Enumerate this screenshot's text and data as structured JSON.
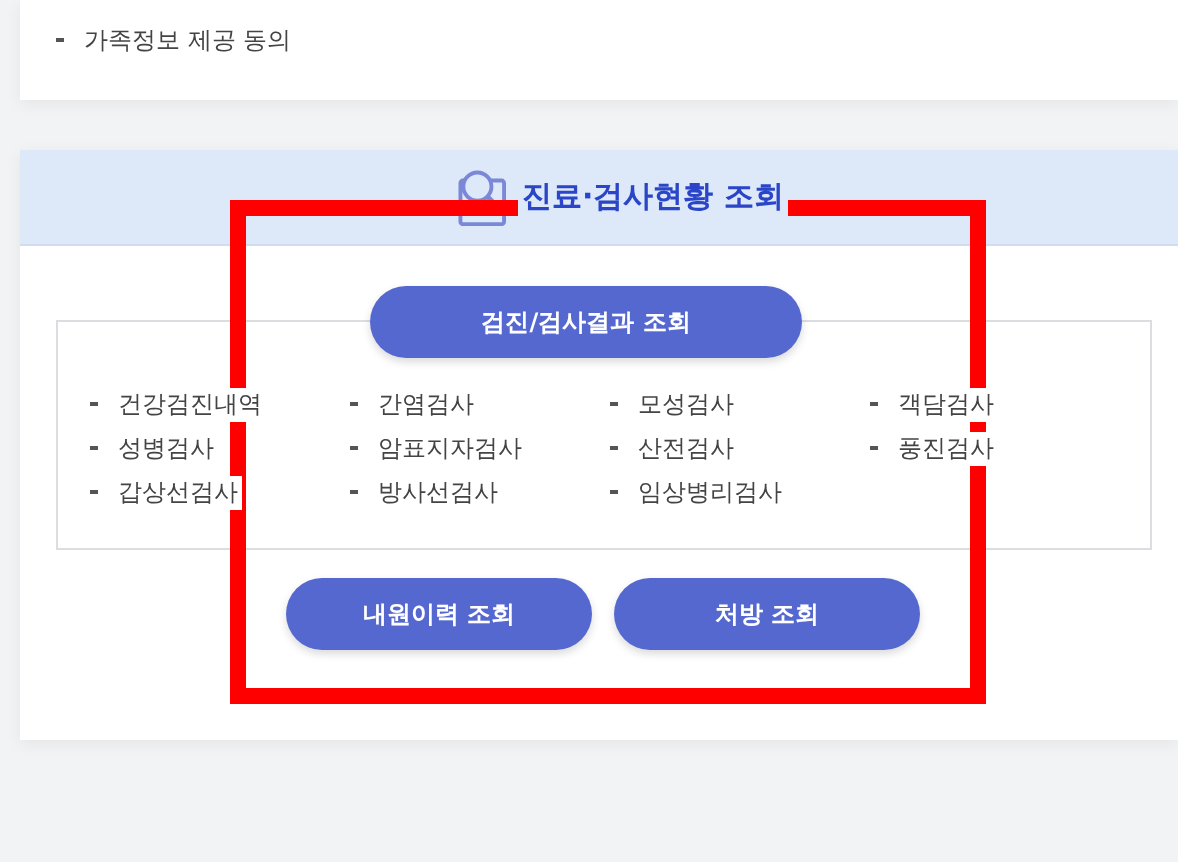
{
  "consent_card": {
    "items": [
      "가족정보 제공 동의"
    ]
  },
  "lookup_card": {
    "title": "진료·검사현황 조회",
    "exam_button": "검진/검사결과 조회",
    "exam_items": [
      "건강검진내역",
      "간염검사",
      "모성검사",
      "객담검사",
      "성병검사",
      "암표지자검사",
      "산전검사",
      "풍진검사",
      "갑상선검사",
      "방사선검사",
      "임상병리검사"
    ],
    "buttons": [
      "내원이력 조회",
      "처방 조회"
    ]
  },
  "highlight": {
    "shown": true
  }
}
